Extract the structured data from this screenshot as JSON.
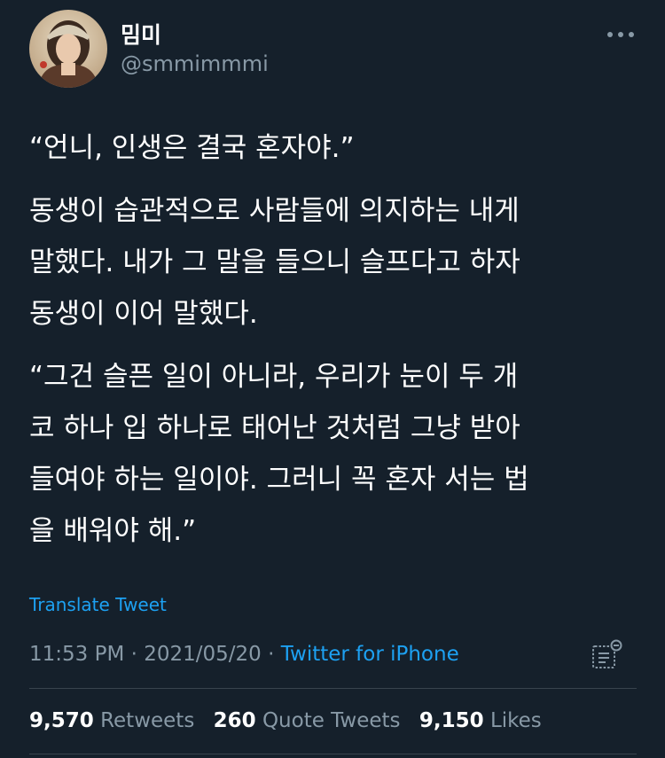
{
  "author": {
    "display_name": "밈미",
    "handle": "@smmimmmi",
    "avatar_icon": "profile-photo"
  },
  "menu_icon": "more-horizontal-icon",
  "tweet": {
    "paragraphs": [
      [
        "“언니, 인생은 결국 혼자야.”"
      ],
      [
        "동생이 습관적으로 사람들에 의지하는 내게",
        "말했다. 내가 그 말을 들으니 슬프다고 하자",
        "동생이 이어 말했다."
      ],
      [
        "“그건 슬픈 일이 아니라, 우리가 눈이 두 개",
        "코 하나 입 하나로 태어난 것처럼 그냥 받아",
        "들여야 하는 일이야. 그러니 꼭 혼자 서는 법",
        "을 배워야 해.”"
      ]
    ],
    "translate_label": "Translate Tweet",
    "time": "11:53 PM",
    "date": "2021/05/20",
    "separator": "·",
    "source": "Twitter for iPhone",
    "analytics_icon": "analytics-icon"
  },
  "stats": {
    "retweets_count": "9,570",
    "retweets_label": "Retweets",
    "quotes_count": "260",
    "quotes_label": "Quote Tweets",
    "likes_count": "9,150",
    "likes_label": "Likes"
  },
  "colors": {
    "background": "#15202b",
    "text_primary": "#ffffff",
    "text_secondary": "#8899a6",
    "link": "#1da1f2",
    "divider": "#38444d"
  }
}
